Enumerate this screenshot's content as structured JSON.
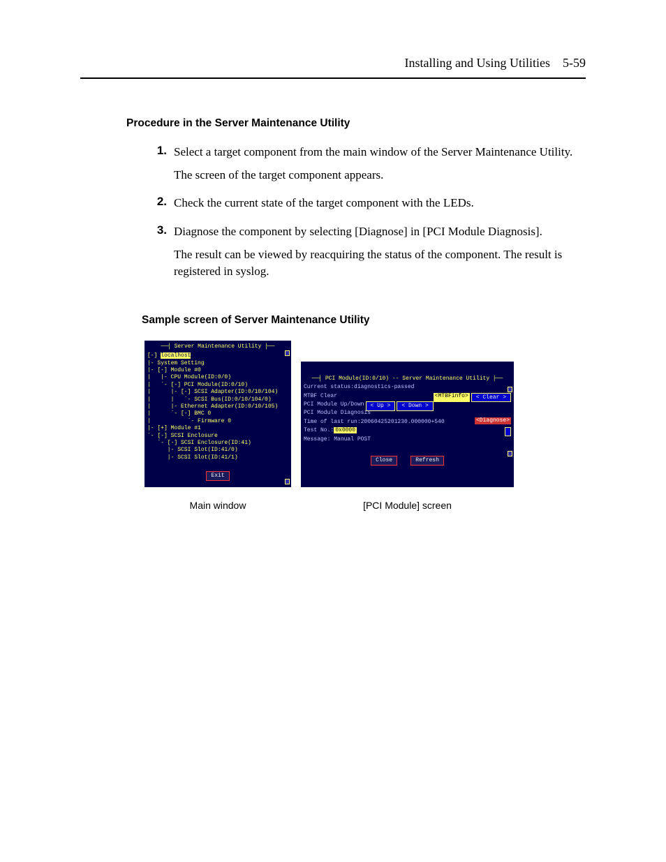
{
  "header": {
    "section": "Installing and Using Utilities",
    "page": "5-59"
  },
  "h1": "Procedure in the Server Maintenance Utility",
  "steps": [
    {
      "n": "1.",
      "a": "Select a target component from the main window of the Server Maintenance Utility.",
      "b": "The screen of the target component appears."
    },
    {
      "n": "2.",
      "a": "Check the current state of the target component with the LEDs."
    },
    {
      "n": "3.",
      "a": "Diagnose the component by selecting [Diagnose] in [PCI Module Diagnosis].",
      "b": "The result can be viewed by reacquiring the status of the component. The result is registered in syslog."
    }
  ],
  "h2": "Sample screen of Server Maintenance Utility",
  "main_window": {
    "title": "Server Maintenance Utility",
    "host": "localhost",
    "tree": [
      "|- System Setting",
      "|- [-] Module #0",
      "|   |- CPU Module(ID:0/0)",
      "|   `- [-] PCI Module(ID:0/10)",
      "|      |- [-] SCSI Adapter(ID:0/10/104)",
      "|      |   `- SCSI Bus(ID:0/10/104/0)",
      "|      |- Ethernet Adapter(ID:0/10/105)",
      "|      `- [-] BMC 0",
      "|           `- Firmware 0",
      "|- [+] Module #1",
      "`- [-] SCSI Enclosure",
      "   `- [-] SCSI Enclosure(ID:41)",
      "      |- SCSI Slot(ID:41/0)",
      "      |- SCSI Slot(ID:41/1)"
    ],
    "exit": "Exit"
  },
  "pci_screen": {
    "title": "PCI Module(ID:0/10) -- Server Maintenance Utility",
    "status_label": "Current status:",
    "status_value": "diagnostics-passed",
    "rows": {
      "mtbf": {
        "label": "MTBF Clear",
        "btn1": "<MTBFinfo>",
        "btn2": "< Clear >"
      },
      "updown": {
        "label": "PCI Module Up/Down",
        "btn1": "<  Up  >",
        "btn2": "< Down >"
      },
      "diag": {
        "label": "PCI Module Diagnosis",
        "btn": "<Diagnose>"
      }
    },
    "lastrun_label": "Time of last run:",
    "lastrun_value": "20060425201230.000000+540",
    "testno_label": "Test No.:",
    "testno_value": "0x0000",
    "message_label": "Message:",
    "message_value": "Manual POST",
    "close": "Close",
    "refresh": "Refresh"
  },
  "captions": {
    "left": "Main window",
    "right": "[PCI Module] screen"
  },
  "chart_data": {
    "type": "table",
    "title": "PCI Module(ID:0/10) -- Server Maintenance Utility",
    "rows": [
      {
        "field": "Current status",
        "value": "diagnostics-passed"
      },
      {
        "field": "MTBF Clear",
        "actions": [
          "MTBFinfo",
          "Clear"
        ]
      },
      {
        "field": "PCI Module Up/Down",
        "actions": [
          "Up",
          "Down"
        ]
      },
      {
        "field": "PCI Module Diagnosis",
        "actions": [
          "Diagnose"
        ]
      },
      {
        "field": "Time of last run",
        "value": "20060425201230.000000+540"
      },
      {
        "field": "Test No.",
        "value": "0x0000"
      },
      {
        "field": "Message",
        "value": "Manual POST"
      }
    ]
  }
}
